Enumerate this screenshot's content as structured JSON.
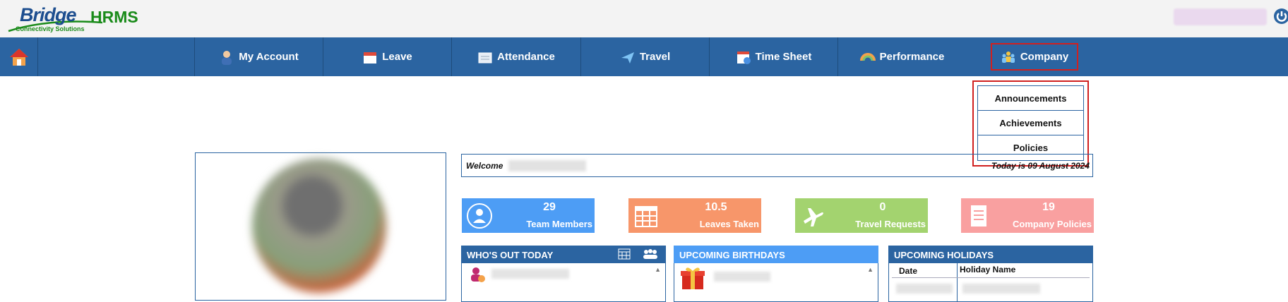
{
  "brand": {
    "logo_main": "Bridge",
    "logo_suffix": "HRMS",
    "tagline": "Connectivity Solutions"
  },
  "nav": {
    "home_icon": "home-icon",
    "items": [
      {
        "label": "My Account",
        "icon": "user-icon"
      },
      {
        "label": "Leave",
        "icon": "calendar-icon"
      },
      {
        "label": "Attendance",
        "icon": "attendance-icon"
      },
      {
        "label": "Travel",
        "icon": "airplane-icon"
      },
      {
        "label": "Time Sheet",
        "icon": "timesheet-icon"
      },
      {
        "label": "Performance",
        "icon": "gauge-icon"
      },
      {
        "label": "Company",
        "icon": "people-icon"
      }
    ]
  },
  "company_menu": {
    "items": [
      "Announcements",
      "Achievements",
      "Policies"
    ]
  },
  "welcome": {
    "label": "Welcome",
    "today": "Today is 09 August 2024"
  },
  "stats": [
    {
      "value": "29",
      "label": "Team Members",
      "color": "#4d9df5"
    },
    {
      "value": "10.5",
      "label": "Leaves Taken",
      "color": "#f7966a"
    },
    {
      "value": "0",
      "label": "Travel Requests",
      "color": "#a3d36f"
    },
    {
      "value": "19",
      "label": "Company Policies",
      "color": "#f9a0a0"
    }
  ],
  "panels": {
    "whos_out": {
      "title": "WHO'S OUT TODAY",
      "color": "#2b64a1"
    },
    "birthdays": {
      "title": "UPCOMING BIRTHDAYS",
      "color": "#4d9df5"
    },
    "holidays": {
      "title": "UPCOMING HOLIDAYS",
      "color": "#2b64a1",
      "col_date": "Date",
      "col_name": "Holiday Name"
    }
  },
  "colors": {
    "nav_bg": "#2b64a1",
    "highlight": "#d0201f"
  }
}
